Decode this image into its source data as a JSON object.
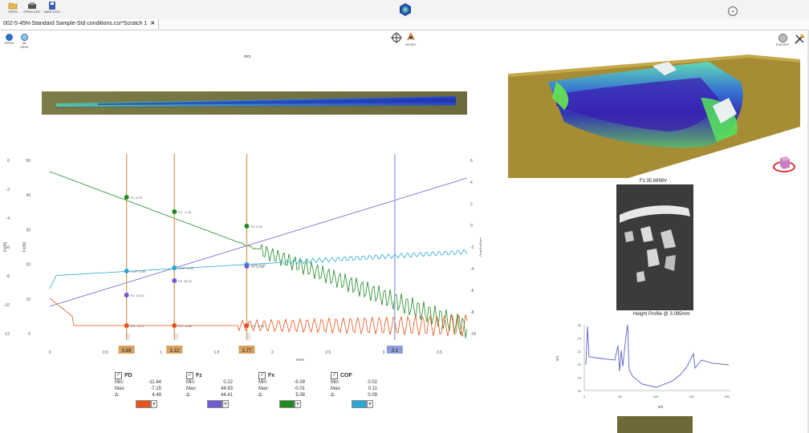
{
  "toolbar": {
    "buttons": [
      {
        "label": "OPEN",
        "icon": "folder-open-icon"
      },
      {
        "label": "OPEN DOC",
        "icon": "open-doc-icon"
      },
      {
        "label": "SAVE DOC",
        "icon": "save-doc-icon"
      }
    ]
  },
  "tab": {
    "title": "002-5-45N-Standard Sample-Std conditions.csr*Scratch 1",
    "close": "✕"
  },
  "view_toolbar": {
    "open": "OPEN",
    "view3d": "3D VIEW",
    "reset": "RESET",
    "export": "EXPORT"
  },
  "scan": {
    "unit_label": "mm"
  },
  "chart_data": {
    "type": "line",
    "xlabel": "mm",
    "x_ticks": [
      "0",
      "0.5",
      "1",
      "1.5",
      "2",
      "2.5",
      "3",
      "3.5"
    ],
    "xlim": [
      0,
      3.75
    ],
    "left_axis_fx": {
      "label": "Fx(N)",
      "ticks": [
        "50",
        "40",
        "30",
        "20",
        "10",
        "0"
      ]
    },
    "left_axis_pd": {
      "label": "Fz(N)",
      "ticks": [
        "0",
        "-2",
        "-4",
        "-6",
        "-8",
        "-10",
        "-12"
      ]
    },
    "right_axis_depth": {
      "label": "Depth(um)",
      "ticks": [
        "6",
        "4",
        "2",
        "0",
        "-2",
        "-4",
        "-6",
        "-8",
        "-10"
      ]
    },
    "right_axis_cof": {
      "label": "COF",
      "ticks": [
        "0.3",
        "0.25",
        "0.2",
        "0.15",
        "0.1",
        "0.05",
        "0",
        "-0.05"
      ]
    },
    "cursors": [
      {
        "x": 0.69,
        "label": "0.69",
        "critical": "Lc1",
        "color": "#d4a060",
        "Fz": "Fz: 6.79",
        "COF": "COF: 0.06",
        "Fx": "Fx: 10.02",
        "PD": "PD: -8.72"
      },
      {
        "x": 1.12,
        "label": "1.12",
        "critical": "Lc2",
        "color": "#d4a060",
        "Fz": "Fz: -1.34",
        "COF": "COF: 0.08",
        "Fx": "Fx: 15.12",
        "PD": "PD: -8.82"
      },
      {
        "x": 1.77,
        "label": "1.77",
        "critical": "Lc3",
        "color": "#d4a060",
        "Fz": "Fz: 4.91",
        "COF": "COF: 0.09",
        "Fx": "Fx: 20.60",
        "PD": "PD: -8.95"
      },
      {
        "x": 3.1,
        "label": "3.1",
        "critical": "",
        "color": "#8e9fd8"
      }
    ],
    "series": [
      {
        "name": "PD",
        "color": "#e8541a"
      },
      {
        "name": "Fz",
        "color": "#6f5bd2"
      },
      {
        "name": "Fx",
        "color": "#1e8a22"
      },
      {
        "name": "COF",
        "color": "#2aa7d6"
      }
    ]
  },
  "legend": [
    {
      "name": "PD",
      "min": "-11.64",
      "max": "-7.15",
      "delta": "4.49",
      "color": "#e8541a"
    },
    {
      "name": "Fz",
      "min": "0.22",
      "max": "44.63",
      "delta": "44.41",
      "color": "#6f5bd2"
    },
    {
      "name": "Fx",
      "min": "-5.09",
      "max": "-0.01",
      "delta": "5.08",
      "color": "#1e8a22"
    },
    {
      "name": "COF",
      "min": "0.02",
      "max": "0.11",
      "delta": "0.09",
      "color": "#2aa7d6"
    }
  ],
  "legend_labels": {
    "min": "Min:",
    "max": "Max:",
    "delta": "Δ:"
  },
  "micrograph": {
    "title": "Fz:35.6998V",
    "caption": "Height Profile @ 3.095mm"
  },
  "profile": {
    "ylabel": "um",
    "xlabel": "um",
    "y_ticks": [
      "26",
      "24",
      "22",
      "20",
      "18",
      "16"
    ],
    "x_ticks": [
      "0",
      "50",
      "100",
      "150",
      "200"
    ]
  }
}
